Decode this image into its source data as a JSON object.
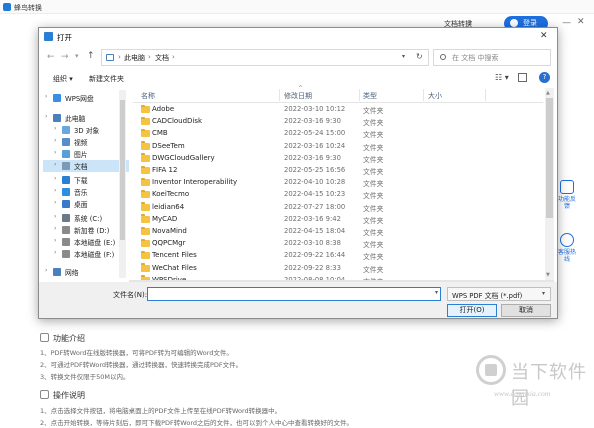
{
  "app": {
    "title": "蜂鸟转换",
    "tab_convert": "文档转换",
    "login_label": "登录",
    "side_tool_1_label": "功能反馈",
    "side_tool_2_label": "客服热线",
    "func_title": "功能介绍",
    "func_lines": [
      "1、PDF转Word在线版转换器，可将PDF转为可编辑的Word文件。",
      "2、可通过PDF转Word转换器，通过转换器，快速转换完成PDF文件。",
      "3、转换文件仅限于50M以内。"
    ],
    "ops_title": "操作说明",
    "ops_lines": [
      "1、点击选择文件按钮，将电脑桌面上的PDF文件上传至在线PDF转Word转换器中。",
      "2、点击开始转换，等待片刻后，即可下载PDF转Word之后的文件，也可以到个人中心中查看转换好的文件。"
    ]
  },
  "watermark": {
    "name": "当下软件园",
    "url": "www.downxia.com"
  },
  "dialog": {
    "title": "打开",
    "breadcrumb": [
      "此电脑",
      "文档"
    ],
    "search_placeholder": "在 文档 中搜索",
    "organize_label": "组织 ▾",
    "new_folder_label": "新建文件夹",
    "nav_items": [
      {
        "label": "WPS网盘",
        "indent": false,
        "selected": false,
        "icon_color": "#3b8ee8",
        "expandable": true
      },
      {
        "label": "此电脑",
        "indent": false,
        "selected": false,
        "icon_color": "#4a7fc0",
        "expandable": true
      },
      {
        "label": "3D 对象",
        "indent": true,
        "selected": false,
        "icon_color": "#6aa6e0",
        "expandable": true
      },
      {
        "label": "视频",
        "indent": true,
        "selected": false,
        "icon_color": "#5a8ec8",
        "expandable": true
      },
      {
        "label": "图片",
        "indent": true,
        "selected": false,
        "icon_color": "#5aa0d8",
        "expandable": true
      },
      {
        "label": "文档",
        "indent": true,
        "selected": true,
        "icon_color": "#7a9ab8",
        "expandable": true
      },
      {
        "label": "下载",
        "indent": true,
        "selected": false,
        "icon_color": "#2a7fd4",
        "expandable": true
      },
      {
        "label": "音乐",
        "indent": true,
        "selected": false,
        "icon_color": "#2a8fe0",
        "expandable": true
      },
      {
        "label": "桌面",
        "indent": true,
        "selected": false,
        "icon_color": "#3a78c8",
        "expandable": true
      },
      {
        "label": "系统 (C:)",
        "indent": true,
        "selected": false,
        "icon_color": "#6a7a8a",
        "expandable": true
      },
      {
        "label": "新加卷 (D:)",
        "indent": true,
        "selected": false,
        "icon_color": "#8a8a8a",
        "expandable": true
      },
      {
        "label": "本地磁盘 (E:)",
        "indent": true,
        "selected": false,
        "icon_color": "#8a8a8a",
        "expandable": true
      },
      {
        "label": "本地磁盘 (F:)",
        "indent": true,
        "selected": false,
        "icon_color": "#8a8a8a",
        "expandable": true
      },
      {
        "label": "网络",
        "indent": false,
        "selected": false,
        "icon_color": "#4a7fc0",
        "expandable": true
      }
    ],
    "columns": [
      "名称",
      "修改日期",
      "类型",
      "大小"
    ],
    "files": [
      {
        "name": "Adobe",
        "date": "2022-03-10 10:12",
        "type": "文件夹"
      },
      {
        "name": "CADCloudDisk",
        "date": "2022-03-16 9:30",
        "type": "文件夹"
      },
      {
        "name": "CMB",
        "date": "2022-05-24 15:00",
        "type": "文件夹"
      },
      {
        "name": "DSeeTem",
        "date": "2022-03-16 10:24",
        "type": "文件夹"
      },
      {
        "name": "DWGCloudGallery",
        "date": "2022-03-16 9:30",
        "type": "文件夹"
      },
      {
        "name": "FIFA 12",
        "date": "2022-05-25 16:56",
        "type": "文件夹"
      },
      {
        "name": "Inventor Interoperability",
        "date": "2022-04-10 10:28",
        "type": "文件夹"
      },
      {
        "name": "KoeiTecmo",
        "date": "2022-04-15 10:23",
        "type": "文件夹"
      },
      {
        "name": "leidian64",
        "date": "2022-07-27 18:00",
        "type": "文件夹"
      },
      {
        "name": "MyCAD",
        "date": "2022-03-16 9:42",
        "type": "文件夹"
      },
      {
        "name": "NovaMind",
        "date": "2022-04-15 18:04",
        "type": "文件夹"
      },
      {
        "name": "QQPCMgr",
        "date": "2022-03-10 8:38",
        "type": "文件夹"
      },
      {
        "name": "Tencent Files",
        "date": "2022-09-22 16:44",
        "type": "文件夹"
      },
      {
        "name": "WeChat Files",
        "date": "2022-09-22 8:33",
        "type": "文件夹"
      },
      {
        "name": "WPSDrive",
        "date": "2022-08-08 10:04",
        "type": "文件夹"
      }
    ],
    "filename_label": "文件名(N):",
    "filename_value": "",
    "filter_label": "WPS PDF 文档 (*.pdf)",
    "open_label": "打开(O)",
    "cancel_label": "取消"
  },
  "colors": {
    "accent": "#1f6fe0",
    "folder": "#f5c343",
    "selected_nav": "#cce4f7"
  }
}
